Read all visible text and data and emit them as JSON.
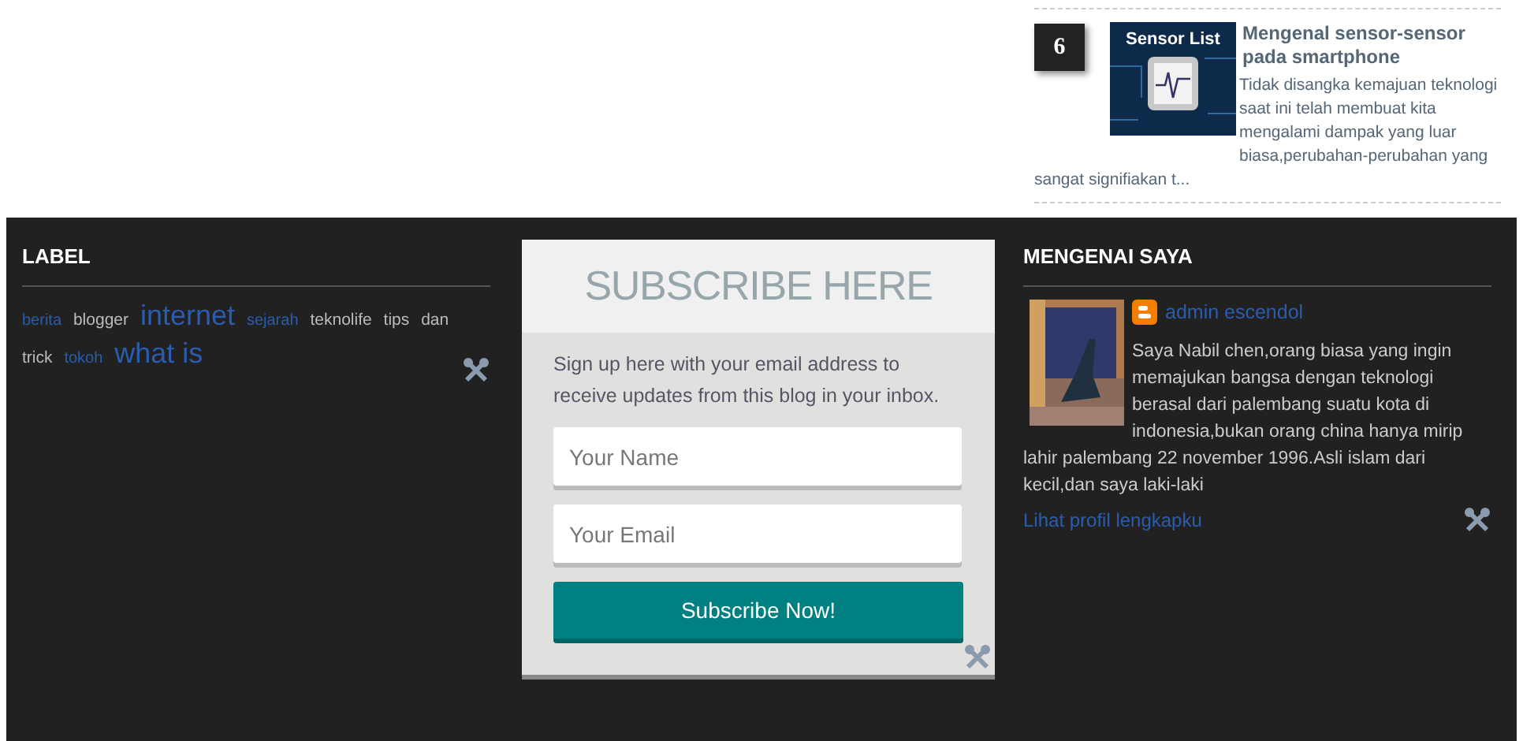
{
  "popular_post": {
    "rank": "6",
    "image_caption": "Sensor List",
    "title": "Mengenal sensor-sensor pada smartphone",
    "excerpt": "Tidak disangka kemajuan teknologi saat ini telah membuat kita mengalami dampak yang luar biasa,perubahan-perubahan yang",
    "excerpt_continued": "sangat signifiakan t..."
  },
  "label_widget": {
    "title": "LABEL",
    "tags": [
      {
        "text": "berita",
        "kind": "small",
        "color": "#2a5db0"
      },
      {
        "text": "blogger",
        "kind": "normal",
        "color": "#bbbbbb"
      },
      {
        "text": "internet",
        "kind": "large",
        "color": "#2a5db0"
      },
      {
        "text": "sejarah",
        "kind": "small",
        "color": "#2a5db0"
      },
      {
        "text": "teknolife",
        "kind": "normal",
        "color": "#bbbbbb"
      },
      {
        "text": "tips",
        "kind": "normal",
        "color": "#bbbbbb"
      },
      {
        "text": "dan",
        "kind": "normal",
        "color": "#bbbbbb"
      },
      {
        "text": "trick",
        "kind": "normal",
        "color": "#bbbbbb"
      },
      {
        "text": "tokoh",
        "kind": "small",
        "color": "#2a5db0"
      },
      {
        "text": "what is",
        "kind": "large",
        "color": "#2a5db0"
      }
    ]
  },
  "subscribe_widget": {
    "title": "SUBSCRIBE HERE",
    "description": "Sign up here with your email address to receive updates from this blog in your inbox.",
    "name_field": {
      "placeholder": "Your Name"
    },
    "email_field": {
      "placeholder": "Your Email"
    },
    "button": "Subscribe Now!"
  },
  "about_widget": {
    "title": "MENGENAI SAYA",
    "author": "admin escendol",
    "bio": "Saya Nabil chen,orang biasa yang ingin memajukan bangsa dengan teknologi berasal dari palembang suatu kota di indonesia,bukan orang china hanya mirip",
    "bio_continued": "lahir palembang 22 november 1996.Asli islam dari kecil,dan saya laki-laki",
    "profile_link": "Lihat profil lengkapku"
  }
}
